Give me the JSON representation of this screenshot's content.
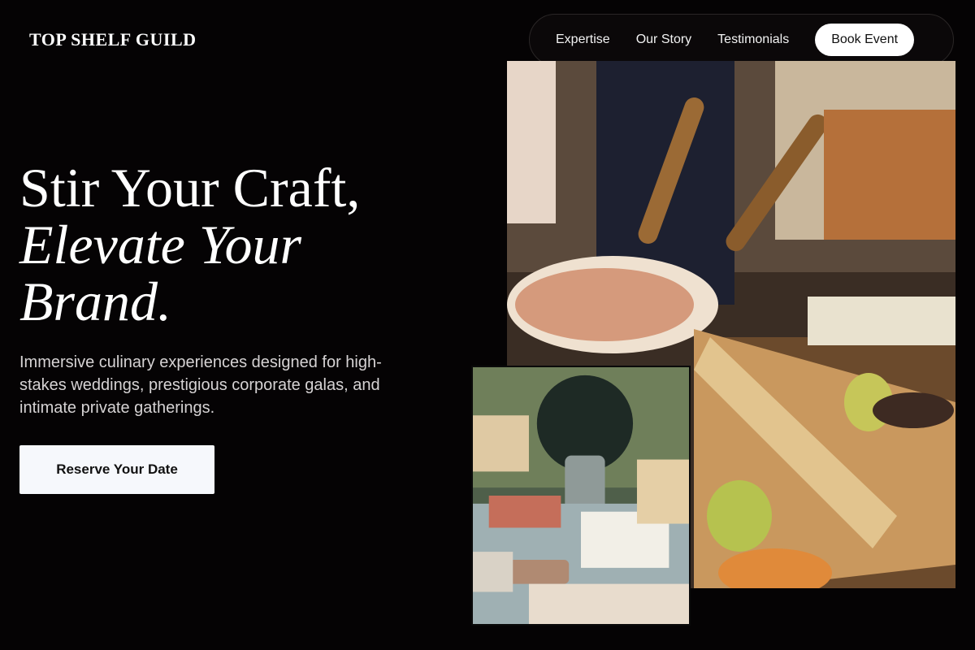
{
  "brand": {
    "name": "TOP SHELF GUILD"
  },
  "nav": {
    "items": [
      {
        "label": "Expertise"
      },
      {
        "label": "Our Story"
      },
      {
        "label": "Testimonials"
      }
    ],
    "book_label": "Book Event"
  },
  "hero": {
    "title_line1": "Stir Your Craft,",
    "title_line2": "Elevate Your",
    "title_line3": "Brand.",
    "subtitle": "Immersive culinary experiences designed for high-stakes weddings, prestigious corporate galas, and intimate private gatherings.",
    "cta_label": "Reserve Your Date"
  },
  "images": {
    "large": {
      "icon": "charcuterie-spread-photo"
    },
    "small": {
      "icon": "outdoor-catering-table-photo"
    }
  },
  "colors": {
    "background": "#050304",
    "accent": "#ffffff",
    "cta_bg": "#f6f8fc"
  }
}
